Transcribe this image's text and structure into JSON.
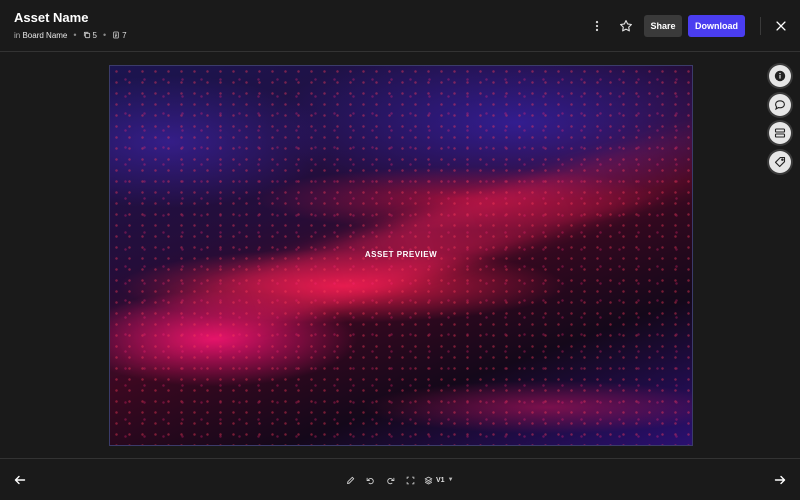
{
  "header": {
    "title": "Asset Name",
    "in_prefix": "in",
    "board_name": "Board Name",
    "stat_1_count": "5",
    "stat_2_count": "7",
    "share_label": "Share",
    "download_label": "Download"
  },
  "preview": {
    "label": "ASSET PREVIEW"
  },
  "footer": {
    "version_label": "V1"
  },
  "colors": {
    "background": "#1a1a1a",
    "accent": "#4a3df0",
    "share_bg": "#3a3a3a",
    "side_button_bg": "#e6e6e6"
  },
  "icons": {
    "header_more": "more-vertical-icon",
    "header_star": "star-icon",
    "header_close": "close-icon",
    "stat_1": "copy-icon",
    "stat_2": "document-icon",
    "side_1": "info-icon",
    "side_2": "comment-icon",
    "side_3": "layout-icon",
    "side_4": "tag-icon",
    "footer_prev": "arrow-left-icon",
    "footer_next": "arrow-right-icon",
    "tool_1": "pencil-icon",
    "tool_2": "undo-icon",
    "tool_3": "redo-icon",
    "tool_4": "crop-icon",
    "version": "layers-icon"
  }
}
